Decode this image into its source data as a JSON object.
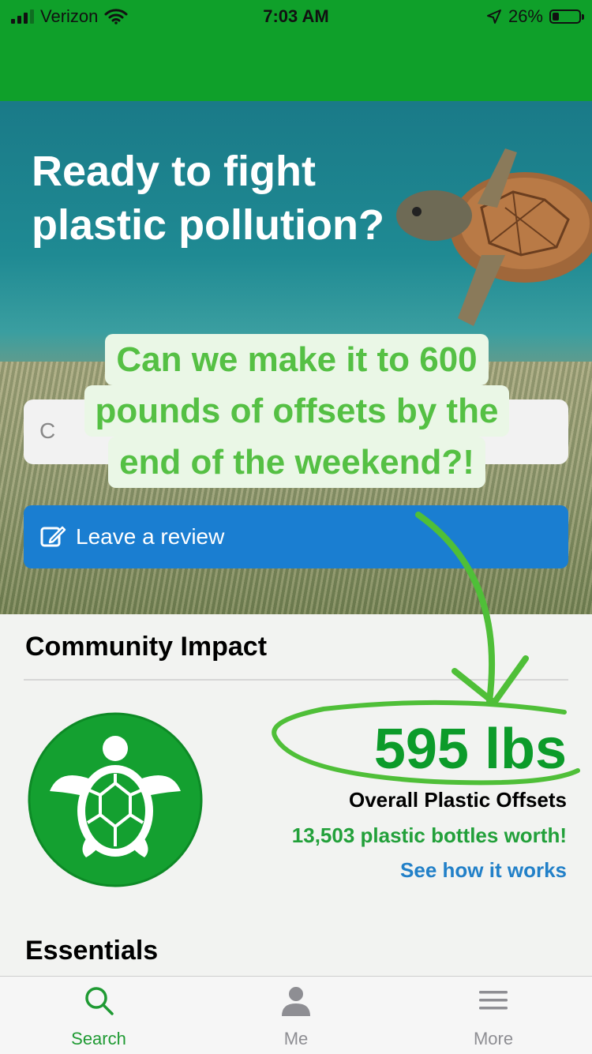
{
  "status_bar": {
    "carrier": "Verizon",
    "time": "7:03 AM",
    "battery": "26%",
    "icons": [
      "signal-icon",
      "wifi-icon",
      "location-icon",
      "battery-icon"
    ]
  },
  "hero": {
    "title_line1": "Ready to fight",
    "title_line2": "plastic pollution?",
    "search_placeholder_glyph": "C"
  },
  "overlay": {
    "line1": "Can we make it to 600",
    "line2": "pounds of offsets by the",
    "line3": "end of the weekend?!"
  },
  "review_button": {
    "label": "Leave a review",
    "icon": "edit-icon"
  },
  "community": {
    "title": "Community Impact",
    "value": "595 lbs",
    "label": "Overall Plastic Offsets",
    "bottles": "13,503 plastic bottles worth!",
    "link": "See how it works"
  },
  "essentials": {
    "title": "Essentials"
  },
  "tabs": [
    {
      "label": "Search",
      "icon": "search-icon",
      "active": true
    },
    {
      "label": "Me",
      "icon": "person-icon",
      "active": false
    },
    {
      "label": "More",
      "icon": "menu-icon",
      "active": false
    }
  ],
  "colors": {
    "brand_green": "#0fa02a",
    "button_blue": "#1a7ed1",
    "link_blue": "#2280c8",
    "tab_active": "#1f9a33",
    "tab_inactive": "#8e8e93"
  }
}
